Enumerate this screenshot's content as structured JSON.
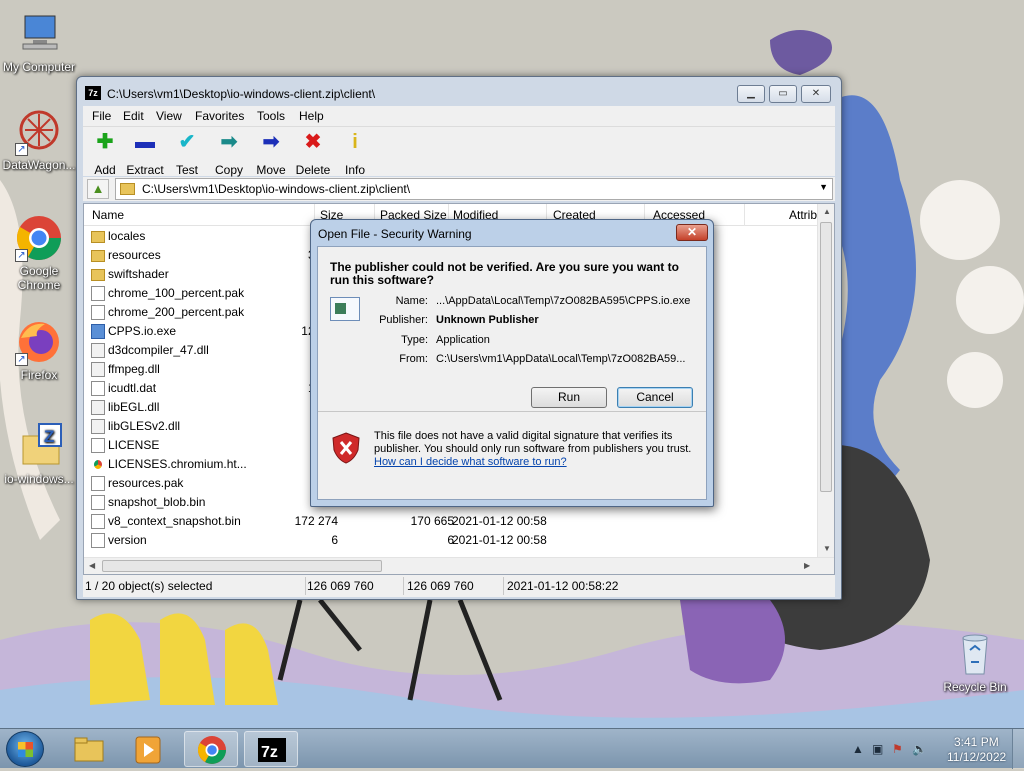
{
  "desktop": {
    "icons": [
      {
        "label": "My Computer",
        "icon": "computer-icon"
      },
      {
        "label": "DataWagon...",
        "icon": "datawagon-icon"
      },
      {
        "label": "Google Chrome",
        "icon": "chrome-icon"
      },
      {
        "label": "Firefox",
        "icon": "firefox-icon"
      },
      {
        "label": "io-windows...",
        "icon": "zip-file-icon"
      },
      {
        "label": "Recycle Bin",
        "icon": "recycle-bin-icon"
      }
    ]
  },
  "fm": {
    "title": "C:\\Users\\vm1\\Desktop\\io-windows-client.zip\\client\\",
    "menu": [
      "File",
      "Edit",
      "View",
      "Favorites",
      "Tools",
      "Help"
    ],
    "toolbar": [
      {
        "label": "Add",
        "icon": "add-icon",
        "color": "#1aa31a",
        "glyph": "✚"
      },
      {
        "label": "Extract",
        "icon": "extract-icon",
        "color": "#1c2fb8",
        "glyph": "▬"
      },
      {
        "label": "Test",
        "icon": "test-icon",
        "color": "#19b6c9",
        "glyph": "✔"
      },
      {
        "label": "Copy",
        "icon": "copy-icon",
        "color": "#1a8a8a",
        "glyph": "➡"
      },
      {
        "label": "Move",
        "icon": "move-icon",
        "color": "#1c2fb8",
        "glyph": "➡"
      },
      {
        "label": "Delete",
        "icon": "delete-icon",
        "color": "#d91a1a",
        "glyph": "✖"
      },
      {
        "label": "Info",
        "icon": "info-icon",
        "color": "#d9b51a",
        "glyph": "i"
      }
    ],
    "address": "C:\\Users\\vm1\\Desktop\\io-windows-client.zip\\client\\",
    "columns": [
      "Name",
      "Size",
      "Packed Size",
      "Modified",
      "Created",
      "Accessed",
      "Attrib"
    ],
    "rows": [
      {
        "name": "locales",
        "size": "6 75",
        "type": "folder",
        "packed": "",
        "modified": ""
      },
      {
        "name": "resources",
        "size": "31 59",
        "type": "folder",
        "packed": "",
        "modified": ""
      },
      {
        "name": "swiftshader",
        "size": "3 71",
        "type": "folder",
        "packed": "",
        "modified": ""
      },
      {
        "name": "chrome_100_percent.pak",
        "size": "12",
        "type": "file",
        "packed": "",
        "modified": ""
      },
      {
        "name": "chrome_200_percent.pak",
        "size": "18",
        "type": "file",
        "packed": "",
        "modified": ""
      },
      {
        "name": "CPPS.io.exe",
        "size": "126 06",
        "type": "exe",
        "packed": "",
        "modified": ""
      },
      {
        "name": "d3dcompiler_47.dll",
        "size": "4 52",
        "type": "dll",
        "packed": "",
        "modified": ""
      },
      {
        "name": "ffmpeg.dll",
        "size": "2 82",
        "type": "dll",
        "packed": "",
        "modified": ""
      },
      {
        "name": "icudtl.dat",
        "size": "10 52",
        "type": "file",
        "packed": "",
        "modified": ""
      },
      {
        "name": "libEGL.dll",
        "size": "44",
        "type": "dll",
        "packed": "",
        "modified": ""
      },
      {
        "name": "libGLESv2.dll",
        "size": "7 62",
        "type": "dll",
        "packed": "",
        "modified": ""
      },
      {
        "name": "LICENSE",
        "size": "",
        "type": "file",
        "packed": "",
        "modified": ""
      },
      {
        "name": "LICENSES.chromium.ht...",
        "size": "4 71",
        "type": "chrome",
        "packed": "",
        "modified": ""
      },
      {
        "name": "resources.pak",
        "size": "5 01",
        "type": "file",
        "packed": "",
        "modified": ""
      },
      {
        "name": "snapshot_blob.bin",
        "size": "5",
        "type": "file",
        "packed": "",
        "modified": ""
      },
      {
        "name": "v8_context_snapshot.bin",
        "size": "172 274",
        "type": "file",
        "packed": "170 665",
        "modified": "2021-01-12 00:58"
      },
      {
        "name": "version",
        "size": "6",
        "type": "file",
        "packed": "6",
        "modified": "2021-01-12 00:58"
      }
    ],
    "status": {
      "selected": "1 / 20 object(s) selected",
      "size": "126 069 760",
      "packed": "126 069 760",
      "modified": "2021-01-12 00:58:22"
    }
  },
  "dialog": {
    "title": "Open File - Security Warning",
    "question": "The publisher could not be verified.  Are you sure you want to run this software?",
    "fields": [
      {
        "key": "Name:",
        "value": "...\\AppData\\Local\\Temp\\7zO082BA595\\CPPS.io.exe",
        "bold": false
      },
      {
        "key": "Publisher:",
        "value": "Unknown Publisher",
        "bold": true
      },
      {
        "key": "Type:",
        "value": "Application",
        "bold": false
      },
      {
        "key": "From:",
        "value": "C:\\Users\\vm1\\AppData\\Local\\Temp\\7zO082BA59...",
        "bold": false
      }
    ],
    "run_label": "Run",
    "cancel_label": "Cancel",
    "warning": "This file does not have a valid digital signature that verifies its publisher.  You should only run software from publishers you trust.",
    "link": "How can I decide what software to run?"
  },
  "taskbar": {
    "apps": [
      {
        "name": "explorer",
        "icon": "folder-icon"
      },
      {
        "name": "media-player",
        "icon": "media-player-icon"
      },
      {
        "name": "chrome",
        "icon": "chrome-icon"
      },
      {
        "name": "7-zip",
        "icon": "7zip-icon"
      }
    ],
    "time": "3:41 PM",
    "date": "11/12/2022"
  }
}
